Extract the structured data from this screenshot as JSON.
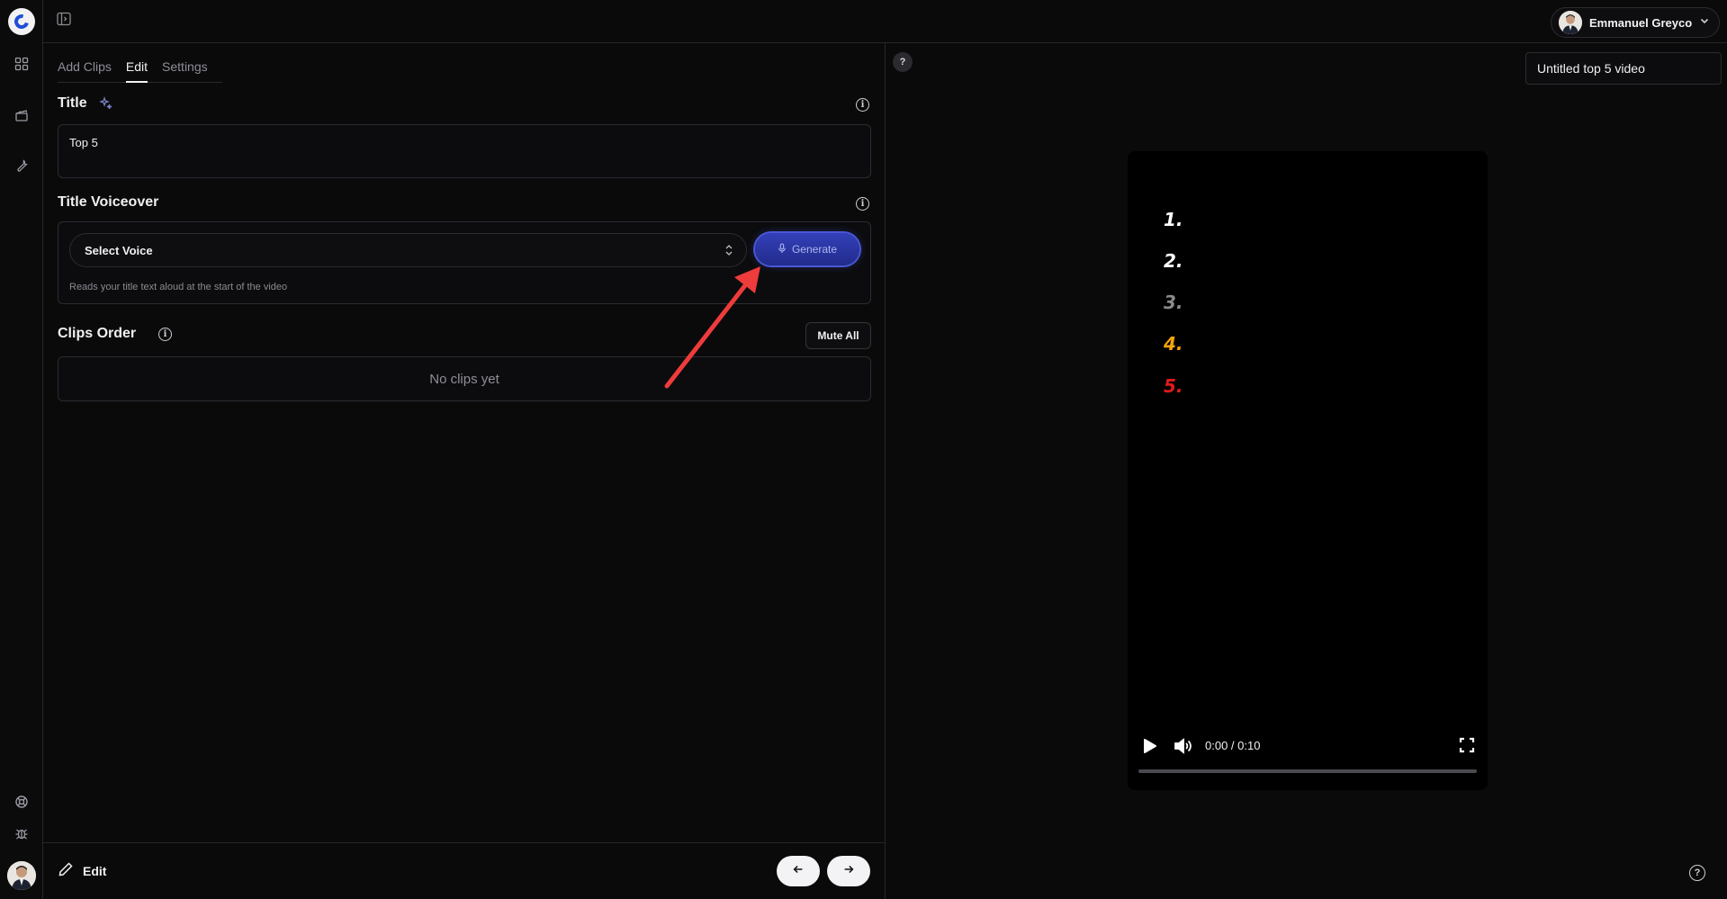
{
  "user": {
    "name": "Emmanuel Greyco"
  },
  "editor": {
    "tabs": [
      {
        "label": "Add Clips",
        "active": false
      },
      {
        "label": "Edit",
        "active": true
      },
      {
        "label": "Settings",
        "active": false
      }
    ],
    "title_section": {
      "label": "Title",
      "value": "Top 5"
    },
    "voiceover": {
      "label": "Title Voiceover",
      "select_value": "Select Voice",
      "generate_label": "Generate",
      "hint": "Reads your title text aloud at the start of the video"
    },
    "clips": {
      "label": "Clips Order",
      "mute_label": "Mute All",
      "empty_text": "No clips yet"
    },
    "footer": {
      "edit_label": "Edit"
    }
  },
  "preview": {
    "help_label": "?",
    "video_name": "Untitled top 5 video",
    "ranks": [
      {
        "label": "1.",
        "color": "#ffffff"
      },
      {
        "label": "2.",
        "color": "#ffffff"
      },
      {
        "label": "3.",
        "color": "#8a8a8a"
      },
      {
        "label": "4.",
        "color": "#f2a50a"
      },
      {
        "label": "5.",
        "color": "#e01b1b"
      }
    ],
    "time": "0:00 / 0:10",
    "progress": 0
  },
  "colors": {
    "accent": "#3340b8",
    "annotation_arrow": "#ee3b3b",
    "background": "#0a0a0b"
  }
}
